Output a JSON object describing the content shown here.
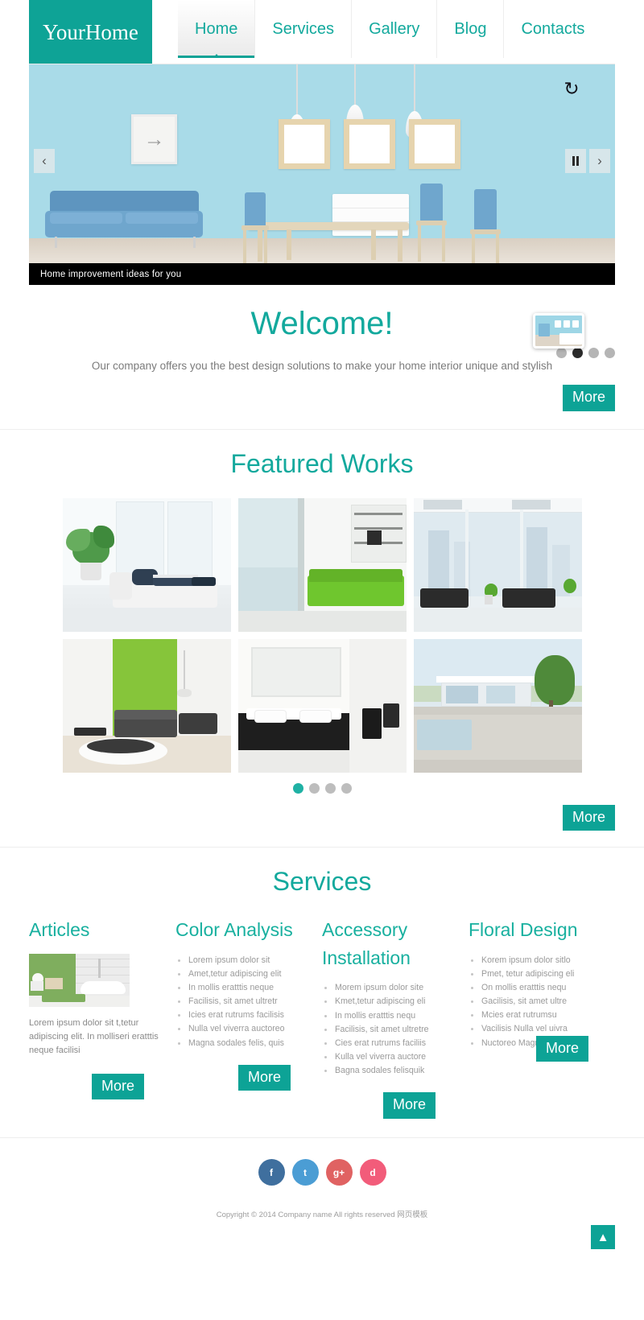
{
  "header": {
    "logo": "YourHome",
    "nav": [
      {
        "label": "Home",
        "active": true
      },
      {
        "label": "Services",
        "active": false
      },
      {
        "label": "Gallery",
        "active": false
      },
      {
        "label": "Blog",
        "active": false
      },
      {
        "label": "Contacts",
        "active": false
      }
    ]
  },
  "slider": {
    "caption": "Home improvement ideas for you",
    "prev_icon": "chevron-left",
    "next_icon": "chevron-right",
    "pause_icon": "pause",
    "refresh_icon": "refresh",
    "prev_glyph": "‹",
    "next_glyph": "›",
    "refresh_glyph": "↻",
    "dots": 4,
    "active_dot": 2
  },
  "welcome": {
    "title": "Welcome!",
    "subtitle": "Our company offers you the best design solutions to make your home interior unique and stylish",
    "more_label": "More"
  },
  "featured": {
    "title": "Featured Works",
    "dots": 4,
    "active_dot": 1,
    "more_label": "More"
  },
  "services": {
    "title": "Services",
    "columns": [
      {
        "heading": "Articles",
        "has_image": true,
        "text": "Lorem ipsum dolor sit t,tetur adipiscing elit. In molliseri eratttis neque facilisi",
        "items": [],
        "more_label": "More"
      },
      {
        "heading": "Color Analysis",
        "has_image": false,
        "text": "",
        "items": [
          "Lorem ipsum dolor sit",
          "Amet,tetur adipiscing elit",
          "In mollis eratttis neque",
          "Facilisis, sit amet ultretr",
          "Icies erat rutrums facilisis",
          "Nulla vel viverra auctoreo",
          "Magna sodales felis, quis"
        ],
        "more_label": "More"
      },
      {
        "heading": "Accessory Installation",
        "has_image": false,
        "text": "",
        "items": [
          "Morem ipsum dolor site",
          "Kmet,tetur adipiscing eli",
          "In mollis eratttis nequ",
          "Facilisis, sit amet ultretre",
          "Cies erat rutrums faciliis",
          "Kulla vel viverra auctore",
          "Bagna sodales felisquik"
        ],
        "more_label": "More"
      },
      {
        "heading": "Floral Design",
        "has_image": false,
        "text": "",
        "items": [
          "Korem ipsum dolor sitlo",
          "Pmet, tetur adipiscing eli",
          "On mollis eratttis nequ",
          "Gacilisis, sit amet ultre",
          "Mcies erat rutrumsu",
          "Vacilisis Nulla vel uivra",
          "Nuctoreo Magna sodale"
        ],
        "more_label": "More"
      }
    ]
  },
  "footer": {
    "socials": [
      {
        "label": "f",
        "name": "facebook",
        "color": "#3f6f9e"
      },
      {
        "label": "t",
        "name": "twitter",
        "color": "#4b9dd4"
      },
      {
        "label": "g+",
        "name": "google-plus",
        "color": "#e06262"
      },
      {
        "label": "d",
        "name": "dribbble",
        "color": "#f25c7a"
      }
    ],
    "copyright": "Copyright © 2014 Company name All rights reserved 网页模板",
    "to_top_glyph": "▲"
  },
  "colors": {
    "brand": "#0da396",
    "heading": "#13a99d"
  }
}
